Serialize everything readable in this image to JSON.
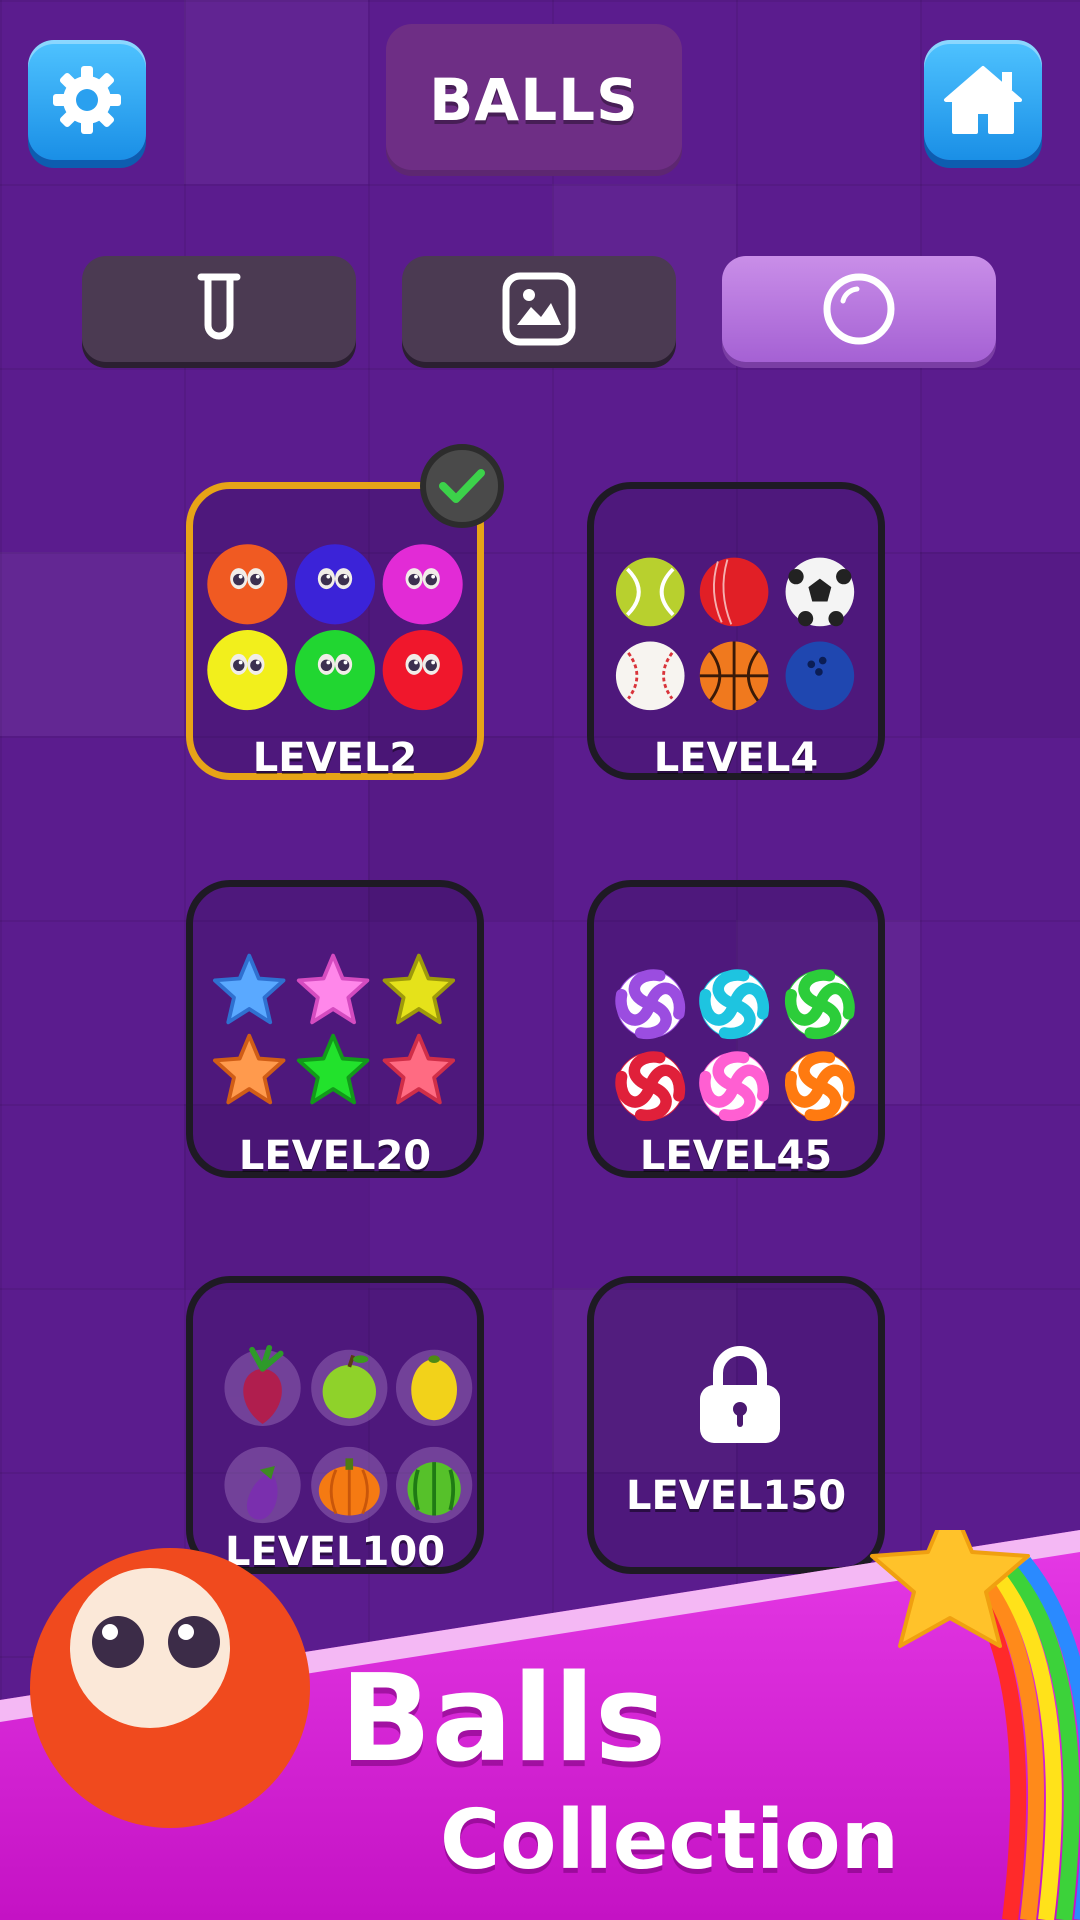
{
  "header": {
    "title": "BALLS",
    "settings_icon": "gear-icon",
    "home_icon": "home-icon"
  },
  "tabs": [
    {
      "icon": "test-tube-icon",
      "active": false
    },
    {
      "icon": "image-icon",
      "active": false
    },
    {
      "icon": "ball-icon",
      "active": true
    }
  ],
  "collection": {
    "items": [
      {
        "label": "LEVEL2",
        "theme": "face-balls",
        "selected": true,
        "locked": false
      },
      {
        "label": "LEVEL4",
        "theme": "sports-balls",
        "selected": false,
        "locked": false
      },
      {
        "label": "LEVEL20",
        "theme": "stars",
        "selected": false,
        "locked": false
      },
      {
        "label": "LEVEL45",
        "theme": "candies",
        "selected": false,
        "locked": false
      },
      {
        "label": "LEVEL100",
        "theme": "fruits",
        "selected": false,
        "locked": false
      },
      {
        "label": "LEVEL150",
        "theme": "locked",
        "selected": false,
        "locked": true
      }
    ]
  },
  "footer": {
    "title": "Balls",
    "subtitle": "Collection"
  },
  "colors": {
    "background": "#5b1c8e",
    "selected_border": "#e7a417",
    "card_border": "#1e1a24",
    "button_blue": "#1a8fe6",
    "tab_active": "#b97ae0",
    "footer_magenta": "#d41fd4"
  }
}
